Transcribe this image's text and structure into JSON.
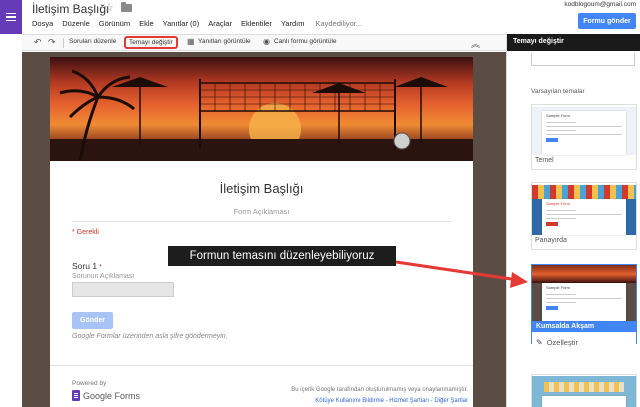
{
  "header": {
    "title": "İletişim Başlığı",
    "user_email": "kodblogoum@gmail.com",
    "send_label": "Formu gönder"
  },
  "menu": {
    "items": [
      "Dosya",
      "Düzenle",
      "Görünüm",
      "Ekle",
      "Yanıtlar (0)",
      "Araçlar",
      "Eklentiler",
      "Yardım"
    ],
    "status": "Kaydediliyor..."
  },
  "toolbar": {
    "edit_questions": "Soruları düzenle",
    "change_theme": "Temayı değiştir",
    "view_responses": "Yanıtları görüntüle",
    "view_live": "Canlı formu görüntüle"
  },
  "form": {
    "title": "İletişim Başlığı",
    "description": "Form Açıklaması",
    "required_note": "* Gerekli",
    "question_title": "Soru 1",
    "question_star": "*",
    "question_desc": "Sorunun Açıklaması",
    "submit_label": "Gönder",
    "never_password": "Google Formlar üzerinden asla şifre göndermeyin.",
    "powered_by": "Powered by",
    "brand": "Google Forms",
    "footer_note": "Bu içerik Google tarafından oluşturulmamış veya onaylanmamıştır.",
    "footer_links": "Kötüye Kullanımı Bildirme - Hizmet Şartları - Diğer Şartlar"
  },
  "callout": {
    "text": "Formun temasını düzenleyebiliyoruz"
  },
  "panel": {
    "header": "Temayı değiştir",
    "default_themes": "Varsayılan temalar",
    "themes": [
      {
        "name": "Temel",
        "sample": "Sample Form"
      },
      {
        "name": "Panayırda",
        "sample": "Sample Form"
      },
      {
        "name": "Kumsalda Akşam",
        "sample": "Sample Form"
      }
    ],
    "customize": "Özelleştir"
  },
  "colors": {
    "accent": "#673ab7",
    "primary": "#4285f4",
    "highlight": "#e53935"
  }
}
